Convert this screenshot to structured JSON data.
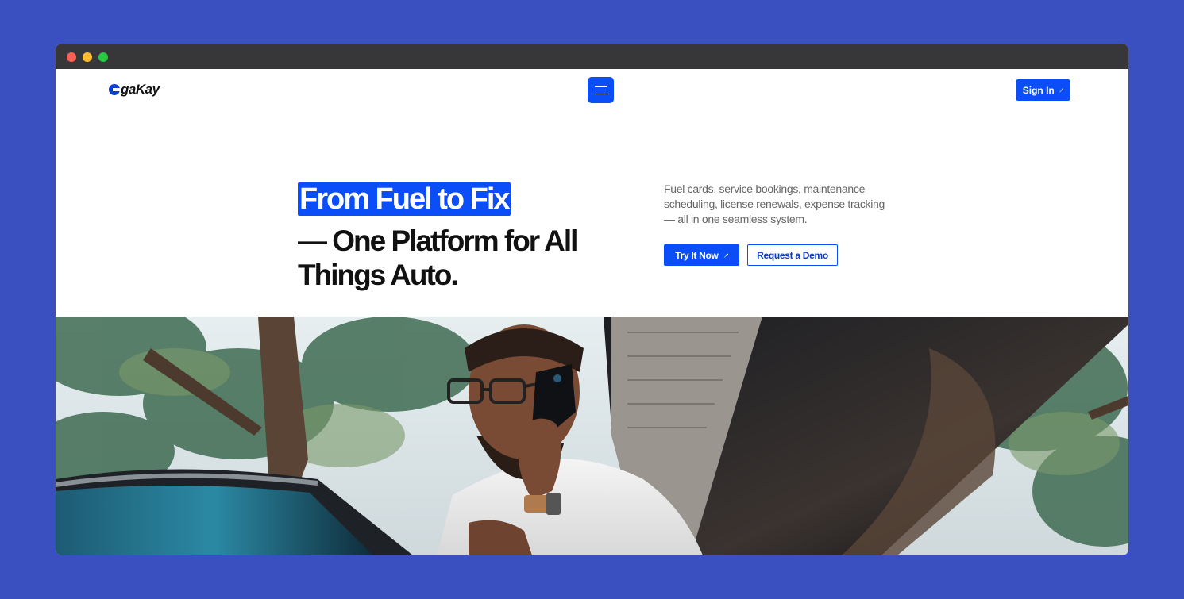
{
  "brand": {
    "name": "gaKay"
  },
  "nav": {
    "menu_icon": "hamburger-menu-icon",
    "signin_label": "Sign In",
    "signin_icon": "arrow-up-right-icon"
  },
  "hero": {
    "headline_highlight": "From Fuel to Fix",
    "headline_rest": "— One Platform for All Things Auto.",
    "description": "Fuel cards, service bookings, maintenance scheduling, license renewals, expense tracking — all in one seamless system.",
    "primary_label": "Try It Now",
    "primary_icon": "arrow-up-right-icon",
    "secondary_label": "Request a Demo"
  },
  "colors": {
    "accent": "#0b4ef7",
    "page_bg": "#3a4fc0",
    "titlebar": "#37373a"
  }
}
